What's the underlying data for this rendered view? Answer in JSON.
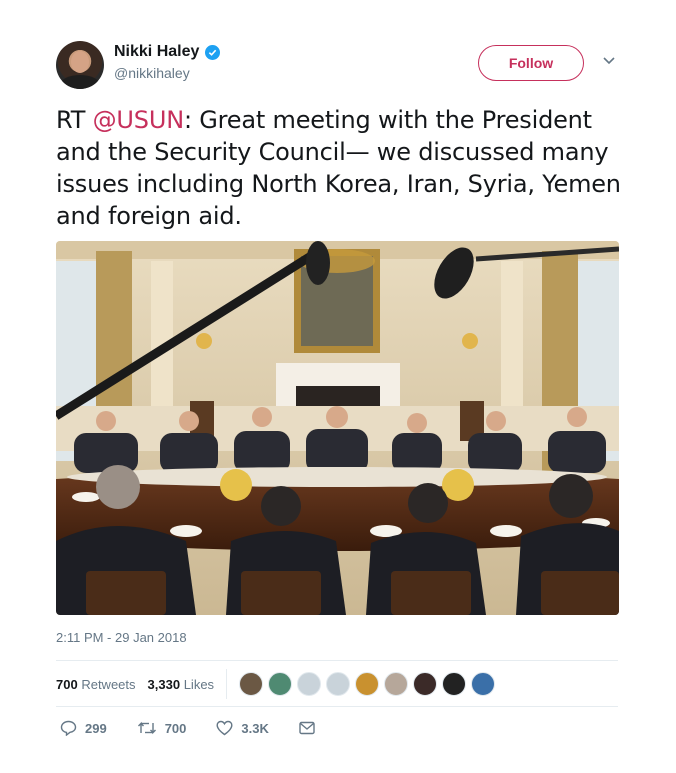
{
  "user": {
    "name": "Nikki Haley",
    "handle": "@nikkihaley",
    "verified": true
  },
  "follow_button": {
    "label": "Follow"
  },
  "tweet": {
    "prefix": "RT ",
    "mention": "@USUN",
    "body": ": Great meeting with the President and the Security Council— we discussed many issues including North Korea, Iran, Syria, Yemen and foreign aid."
  },
  "timestamp": "2:11 PM - 29 Jan 2018",
  "stats": {
    "retweets_count": "700",
    "retweets_label": "Retweets",
    "likes_count": "3,330",
    "likes_label": "Likes"
  },
  "actions": {
    "reply_count": "299",
    "retweet_count": "700",
    "like_count": "3.3K"
  },
  "icons": [
    "verified-badge-icon",
    "chevron-down-icon",
    "reply-icon",
    "retweet-icon",
    "heart-icon",
    "direct-message-icon"
  ],
  "colors": {
    "accent": "#c6305c",
    "verified": "#1da1f2",
    "secondary_text": "#657786",
    "divider": "#e6ecf0"
  }
}
